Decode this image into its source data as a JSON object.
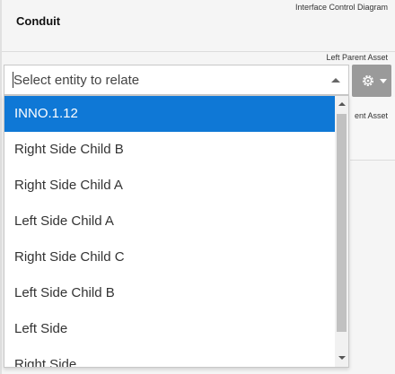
{
  "header": {
    "title": "Conduit",
    "caption": "Interface Control Diagram"
  },
  "section": {
    "caption": "Left Parent Asset",
    "caption_partial": "ent Asset"
  },
  "select": {
    "placeholder": "Select entity to relate"
  },
  "gear_button": {
    "icon": "gear-icon"
  },
  "dropdown": {
    "options": [
      {
        "label": "INNO.1.12",
        "selected": true
      },
      {
        "label": "Right Side Child B"
      },
      {
        "label": "Right Side Child A"
      },
      {
        "label": "Left Side Child A"
      },
      {
        "label": "Right Side Child C"
      },
      {
        "label": "Left Side Child B"
      },
      {
        "label": "Left Side"
      },
      {
        "label": "Right Side"
      }
    ],
    "selected_color": "#0f78d6"
  }
}
